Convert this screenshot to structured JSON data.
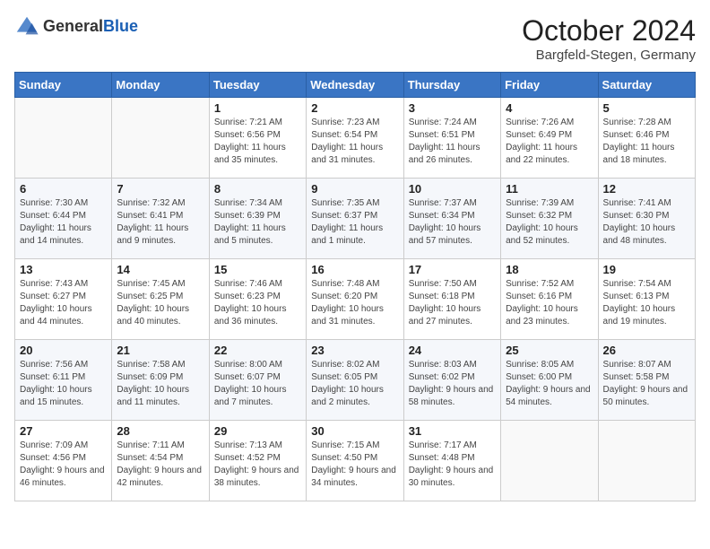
{
  "header": {
    "logo_general": "General",
    "logo_blue": "Blue",
    "month": "October 2024",
    "location": "Bargfeld-Stegen, Germany"
  },
  "days_of_week": [
    "Sunday",
    "Monday",
    "Tuesday",
    "Wednesday",
    "Thursday",
    "Friday",
    "Saturday"
  ],
  "weeks": [
    [
      {
        "day": "",
        "info": ""
      },
      {
        "day": "",
        "info": ""
      },
      {
        "day": "1",
        "info": "Sunrise: 7:21 AM\nSunset: 6:56 PM\nDaylight: 11 hours and 35 minutes."
      },
      {
        "day": "2",
        "info": "Sunrise: 7:23 AM\nSunset: 6:54 PM\nDaylight: 11 hours and 31 minutes."
      },
      {
        "day": "3",
        "info": "Sunrise: 7:24 AM\nSunset: 6:51 PM\nDaylight: 11 hours and 26 minutes."
      },
      {
        "day": "4",
        "info": "Sunrise: 7:26 AM\nSunset: 6:49 PM\nDaylight: 11 hours and 22 minutes."
      },
      {
        "day": "5",
        "info": "Sunrise: 7:28 AM\nSunset: 6:46 PM\nDaylight: 11 hours and 18 minutes."
      }
    ],
    [
      {
        "day": "6",
        "info": "Sunrise: 7:30 AM\nSunset: 6:44 PM\nDaylight: 11 hours and 14 minutes."
      },
      {
        "day": "7",
        "info": "Sunrise: 7:32 AM\nSunset: 6:41 PM\nDaylight: 11 hours and 9 minutes."
      },
      {
        "day": "8",
        "info": "Sunrise: 7:34 AM\nSunset: 6:39 PM\nDaylight: 11 hours and 5 minutes."
      },
      {
        "day": "9",
        "info": "Sunrise: 7:35 AM\nSunset: 6:37 PM\nDaylight: 11 hours and 1 minute."
      },
      {
        "day": "10",
        "info": "Sunrise: 7:37 AM\nSunset: 6:34 PM\nDaylight: 10 hours and 57 minutes."
      },
      {
        "day": "11",
        "info": "Sunrise: 7:39 AM\nSunset: 6:32 PM\nDaylight: 10 hours and 52 minutes."
      },
      {
        "day": "12",
        "info": "Sunrise: 7:41 AM\nSunset: 6:30 PM\nDaylight: 10 hours and 48 minutes."
      }
    ],
    [
      {
        "day": "13",
        "info": "Sunrise: 7:43 AM\nSunset: 6:27 PM\nDaylight: 10 hours and 44 minutes."
      },
      {
        "day": "14",
        "info": "Sunrise: 7:45 AM\nSunset: 6:25 PM\nDaylight: 10 hours and 40 minutes."
      },
      {
        "day": "15",
        "info": "Sunrise: 7:46 AM\nSunset: 6:23 PM\nDaylight: 10 hours and 36 minutes."
      },
      {
        "day": "16",
        "info": "Sunrise: 7:48 AM\nSunset: 6:20 PM\nDaylight: 10 hours and 31 minutes."
      },
      {
        "day": "17",
        "info": "Sunrise: 7:50 AM\nSunset: 6:18 PM\nDaylight: 10 hours and 27 minutes."
      },
      {
        "day": "18",
        "info": "Sunrise: 7:52 AM\nSunset: 6:16 PM\nDaylight: 10 hours and 23 minutes."
      },
      {
        "day": "19",
        "info": "Sunrise: 7:54 AM\nSunset: 6:13 PM\nDaylight: 10 hours and 19 minutes."
      }
    ],
    [
      {
        "day": "20",
        "info": "Sunrise: 7:56 AM\nSunset: 6:11 PM\nDaylight: 10 hours and 15 minutes."
      },
      {
        "day": "21",
        "info": "Sunrise: 7:58 AM\nSunset: 6:09 PM\nDaylight: 10 hours and 11 minutes."
      },
      {
        "day": "22",
        "info": "Sunrise: 8:00 AM\nSunset: 6:07 PM\nDaylight: 10 hours and 7 minutes."
      },
      {
        "day": "23",
        "info": "Sunrise: 8:02 AM\nSunset: 6:05 PM\nDaylight: 10 hours and 2 minutes."
      },
      {
        "day": "24",
        "info": "Sunrise: 8:03 AM\nSunset: 6:02 PM\nDaylight: 9 hours and 58 minutes."
      },
      {
        "day": "25",
        "info": "Sunrise: 8:05 AM\nSunset: 6:00 PM\nDaylight: 9 hours and 54 minutes."
      },
      {
        "day": "26",
        "info": "Sunrise: 8:07 AM\nSunset: 5:58 PM\nDaylight: 9 hours and 50 minutes."
      }
    ],
    [
      {
        "day": "27",
        "info": "Sunrise: 7:09 AM\nSunset: 4:56 PM\nDaylight: 9 hours and 46 minutes."
      },
      {
        "day": "28",
        "info": "Sunrise: 7:11 AM\nSunset: 4:54 PM\nDaylight: 9 hours and 42 minutes."
      },
      {
        "day": "29",
        "info": "Sunrise: 7:13 AM\nSunset: 4:52 PM\nDaylight: 9 hours and 38 minutes."
      },
      {
        "day": "30",
        "info": "Sunrise: 7:15 AM\nSunset: 4:50 PM\nDaylight: 9 hours and 34 minutes."
      },
      {
        "day": "31",
        "info": "Sunrise: 7:17 AM\nSunset: 4:48 PM\nDaylight: 9 hours and 30 minutes."
      },
      {
        "day": "",
        "info": ""
      },
      {
        "day": "",
        "info": ""
      }
    ]
  ]
}
